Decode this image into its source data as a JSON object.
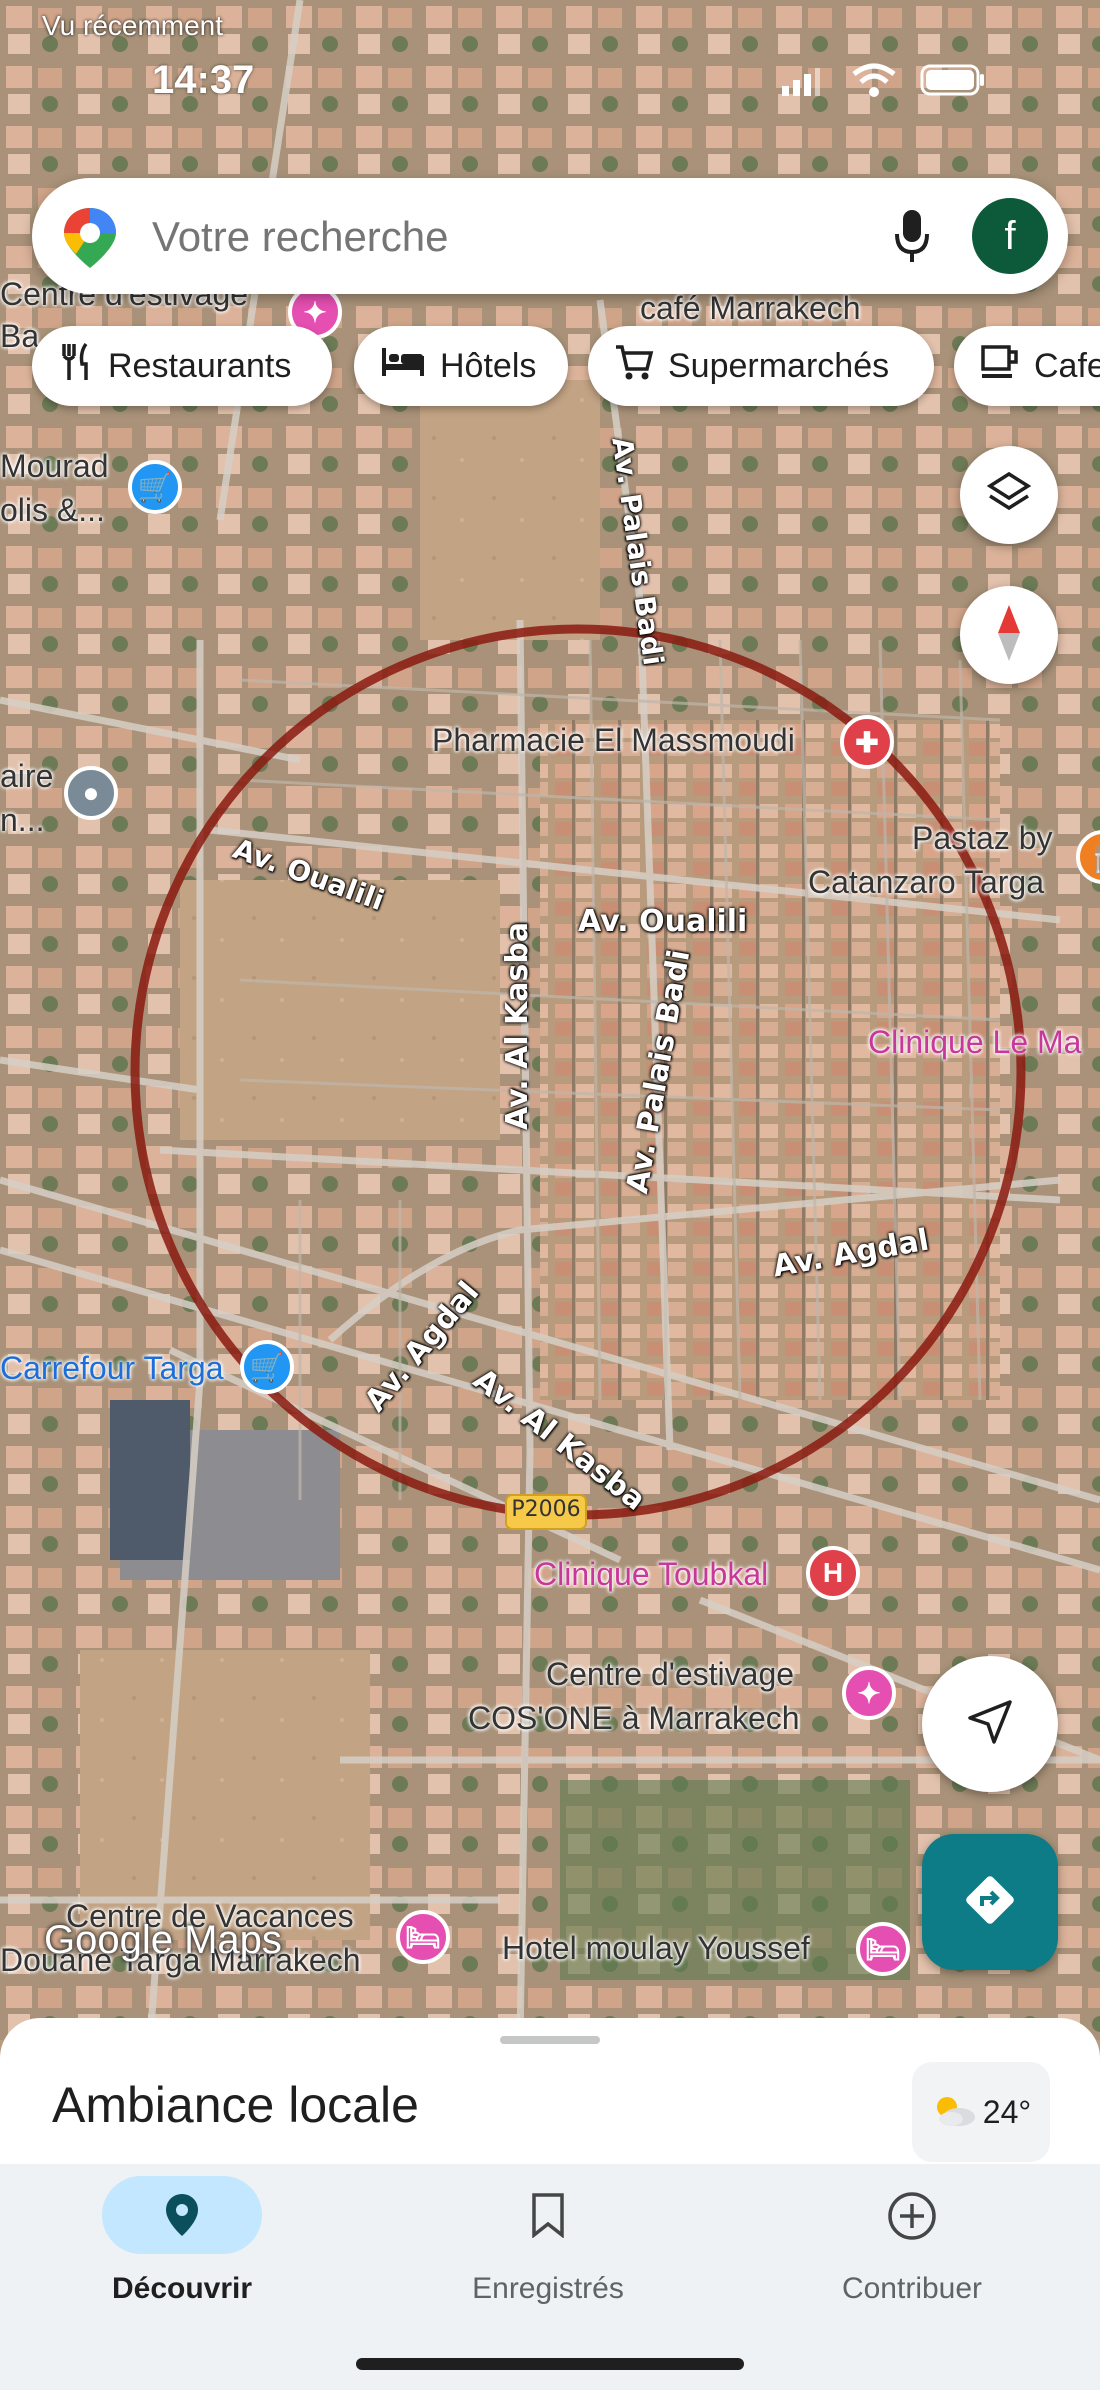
{
  "status": {
    "time": "14:37",
    "recent_text": "Vu récemment"
  },
  "search": {
    "placeholder": "Votre recherche",
    "avatar_letter": "f"
  },
  "chips": [
    {
      "label": "Restaurants",
      "icon": "fork-knife-icon"
    },
    {
      "label": "Hôtels",
      "icon": "bed-icon"
    },
    {
      "label": "Supermarchés",
      "icon": "cart-icon"
    },
    {
      "label": "Cafe",
      "icon": "cup-icon"
    }
  ],
  "map": {
    "roads": {
      "av_oualili_1": "Av. Oualili",
      "av_oualili_2": "Av. Oualili",
      "av_al_kasba_1": "Av. Al Kasba",
      "av_al_kasba_2": "Av. Al Kasba",
      "av_palais_badi_1": "Av. Palais Badi",
      "av_palais_badi_2": "Av. Palais Badi",
      "av_agdal_1": "Av. Agdal",
      "av_agdal_2": "Av. Agdal",
      "p2006": "P2006"
    },
    "pois": {
      "pharmacie": "Pharmacie El Massmoudi",
      "pastaz_1": "Pastaz by",
      "pastaz_2": "Catanzaro Targa",
      "clinique_le_ma": "Clinique Le Ma",
      "carrefour": "Carrefour Targa",
      "clinique_toubkal": "Clinique Toubkal",
      "centre_cos_1": "Centre d'estivage",
      "centre_cos_2": "COS'ONE à Marrakech",
      "centre_top_1": "Centre d'estivage",
      "centre_top_2": "Ba",
      "cafe_marrakech": "café Marrakech",
      "mourad_1": "Mourad",
      "mourad_2": "olis &...",
      "aire_1": "aire",
      "aire_2": "n...",
      "centre_vacances": "Centre de Vacances",
      "douane": "Douane Targa Marrakech",
      "hotel_moulay": "Hotel moulay Youssef",
      "hospital_letter": "H"
    },
    "attribution": "Google Maps",
    "circle_color": "#8b1a10"
  },
  "sheet": {
    "title": "Ambiance locale",
    "weather": "24°"
  },
  "nav": [
    {
      "label": "Découvrir",
      "icon": "pin-icon",
      "active": true
    },
    {
      "label": "Enregistrés",
      "icon": "bookmark-icon",
      "active": false
    },
    {
      "label": "Contribuer",
      "icon": "plus-circle-icon",
      "active": false
    }
  ]
}
